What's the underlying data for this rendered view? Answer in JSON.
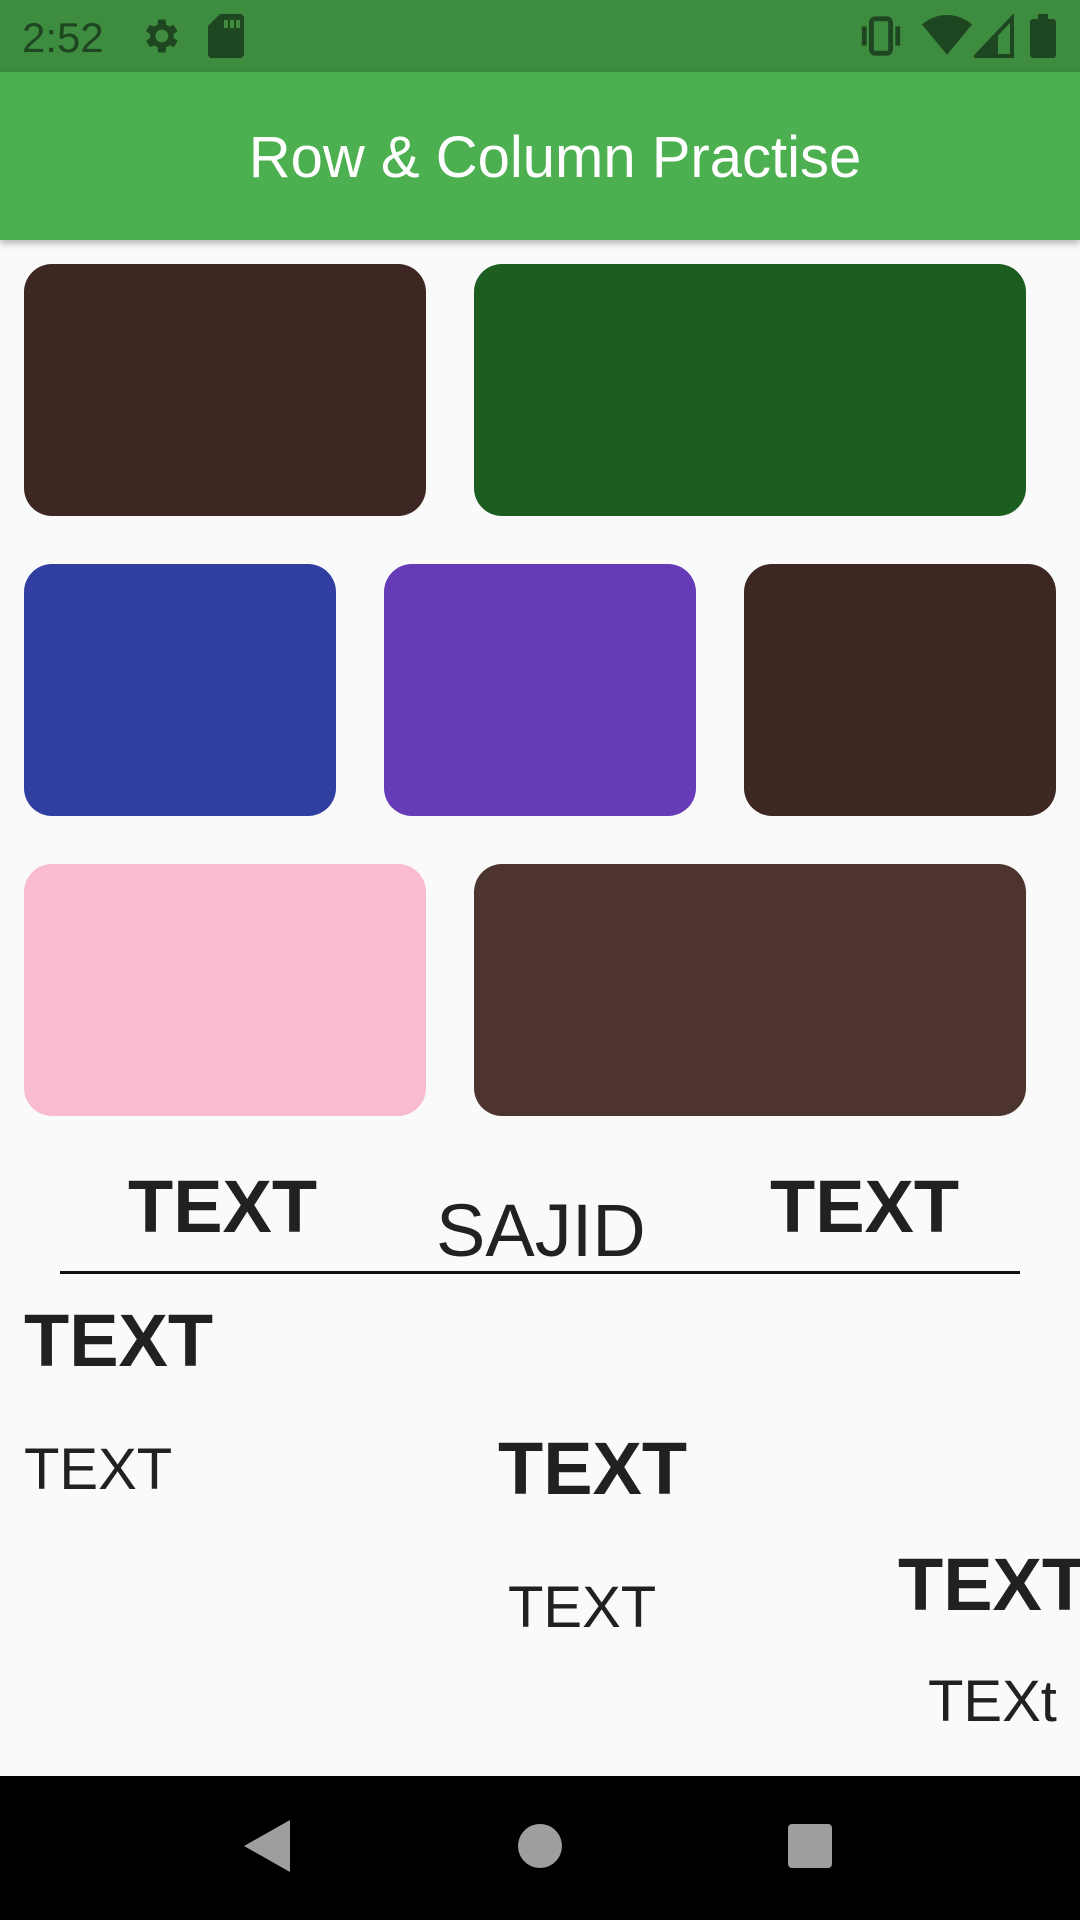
{
  "status_bar": {
    "time": "2:52",
    "icons": [
      "gear-icon",
      "sd-card-icon",
      "vibrate-icon",
      "wifi-icon",
      "signal-icon",
      "battery-icon"
    ]
  },
  "app_bar": {
    "title": "Row & Column Practise"
  },
  "boxes": {
    "row1": [
      {
        "color": "#3e2723"
      },
      {
        "color": "#1b5e20"
      }
    ],
    "row2": [
      {
        "color": "#303f9f"
      },
      {
        "color": "#673ab7"
      },
      {
        "color": "#3e2723"
      }
    ],
    "row3": [
      {
        "color": "#f8bbd0"
      },
      {
        "color": "#4e342e"
      }
    ]
  },
  "text_row": {
    "left": "TEXT",
    "center": "SAJID",
    "right": "TEXT"
  },
  "column_texts": {
    "c1_bold": "TEXT",
    "c1_regular": "TEXT",
    "c2_bold": "TEXT",
    "c2_regular": "TEXT",
    "c3_bold": "TEXT",
    "c3_regular": "TEXt"
  },
  "nav": {
    "icons": [
      "back-icon",
      "home-icon",
      "recents-icon"
    ]
  }
}
